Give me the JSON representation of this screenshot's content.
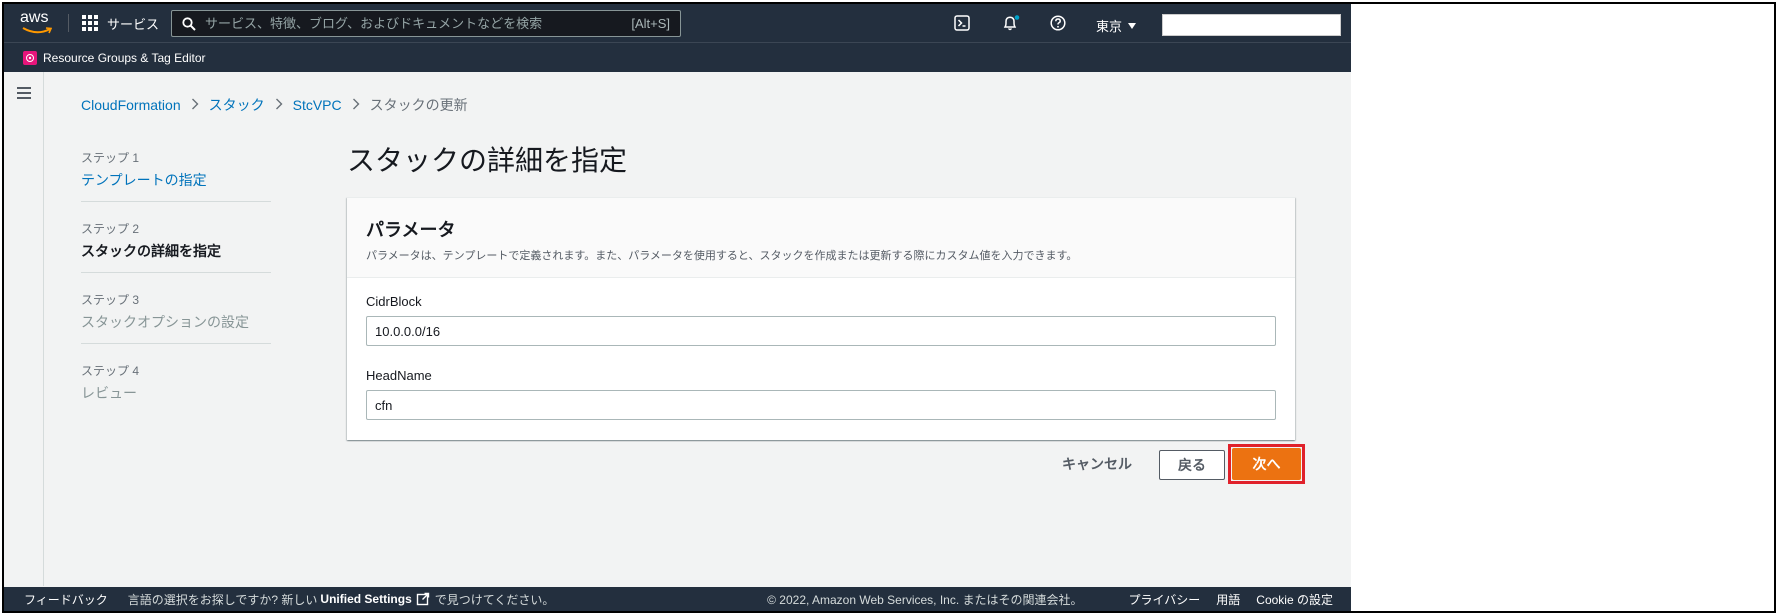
{
  "topnav": {
    "logo_text": "aws",
    "services_label": "サービス",
    "search_placeholder": "サービス、特徴、ブログ、およびドキュメントなどを検索",
    "search_shortcut": "[Alt+S]",
    "region_label": "東京",
    "icons": [
      "cloudshell-icon",
      "bell-icon",
      "help-icon"
    ],
    "notification_dot_color": "#00a1c9"
  },
  "subnav": {
    "pinned_service_label": "Resource Groups & Tag Editor",
    "pinned_service_color": "#e7157b"
  },
  "breadcrumb": {
    "items": [
      "CloudFormation",
      "スタック",
      "StcVPC"
    ],
    "current": "スタックの更新"
  },
  "steps": [
    {
      "num": "ステップ 1",
      "name": "テンプレートの指定"
    },
    {
      "num": "ステップ 2",
      "name": "スタックの詳細を指定"
    },
    {
      "num": "ステップ 3",
      "name": "スタックオプションの設定"
    },
    {
      "num": "ステップ 4",
      "name": "レビュー"
    }
  ],
  "page": {
    "title": "スタックの詳細を指定"
  },
  "panel": {
    "title": "パラメータ",
    "description": "パラメータは、テンプレートで定義されます。また、パラメータを使用すると、スタックを作成または更新する際にカスタム値を入力できます。",
    "fields": [
      {
        "label": "CidrBlock",
        "value": "10.0.0.0/16"
      },
      {
        "label": "HeadName",
        "value": "cfn"
      }
    ]
  },
  "actions": {
    "cancel_label": "キャンセル",
    "back_label": "戻る",
    "next_label": "次へ",
    "accent_color": "#ec7211",
    "highlight_color": "#e0212b"
  },
  "footer": {
    "feedback_label": "フィードバック",
    "lang_text_before": "言語の選択をお探しですか? 新しい",
    "unified_settings_label": "Unified Settings",
    "lang_text_after": "で見つけてください。",
    "copyright": "© 2022, Amazon Web Services, Inc. またはその関連会社。",
    "privacy_label": "プライバシー",
    "terms_label": "用語",
    "cookie_label": "Cookie の設定"
  }
}
